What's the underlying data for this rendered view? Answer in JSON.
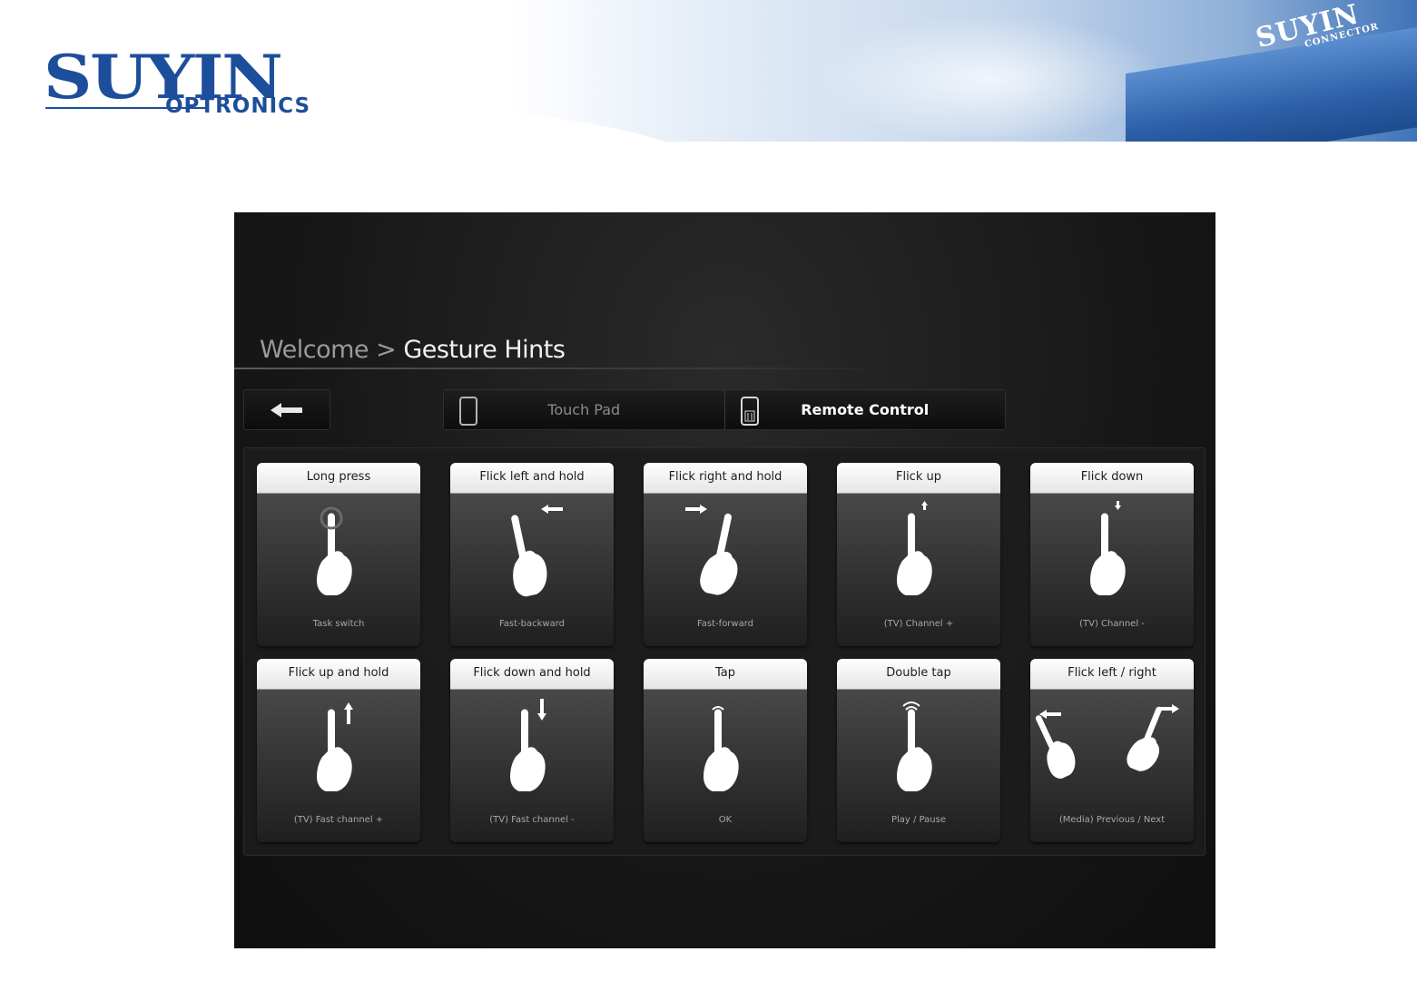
{
  "banner": {
    "logo_main": "SUYIN",
    "logo_sub": "OPTRONICS",
    "building_sign_main": "SUYIN",
    "building_sign_sub": "CONNECTOR",
    "brand_color": "#1d4e9b"
  },
  "breadcrumb": {
    "parent": "Welcome",
    "separator": " > ",
    "current": "Gesture Hints"
  },
  "back_button": {
    "icon": "arrow-left-icon"
  },
  "mode_tabs": [
    {
      "label": "Touch Pad",
      "icon": "tablet-icon",
      "selected": false
    },
    {
      "label": "Remote Control",
      "icon": "remote-control-icon",
      "selected": true
    }
  ],
  "gestures": [
    {
      "title": "Long press",
      "caption": "Task switch",
      "icon": "long-press-icon"
    },
    {
      "title": "Flick left and hold",
      "caption": "Fast-backward",
      "icon": "flick-left-hold-icon"
    },
    {
      "title": "Flick right and hold",
      "caption": "Fast-forward",
      "icon": "flick-right-hold-icon"
    },
    {
      "title": "Flick up",
      "caption": "(TV) Channel +",
      "icon": "flick-up-icon"
    },
    {
      "title": "Flick down",
      "caption": "(TV) Channel -",
      "icon": "flick-down-icon"
    },
    {
      "title": "Flick up and hold",
      "caption": "(TV) Fast channel +",
      "icon": "flick-up-hold-icon"
    },
    {
      "title": "Flick down and hold",
      "caption": "(TV) Fast channel -",
      "icon": "flick-down-hold-icon"
    },
    {
      "title": "Tap",
      "caption": "OK",
      "icon": "tap-icon"
    },
    {
      "title": "Double tap",
      "caption": "Play / Pause",
      "icon": "double-tap-icon"
    },
    {
      "title": "Flick left / right",
      "caption": "(Media) Previous / Next",
      "icon": "flick-left-right-icon"
    }
  ]
}
